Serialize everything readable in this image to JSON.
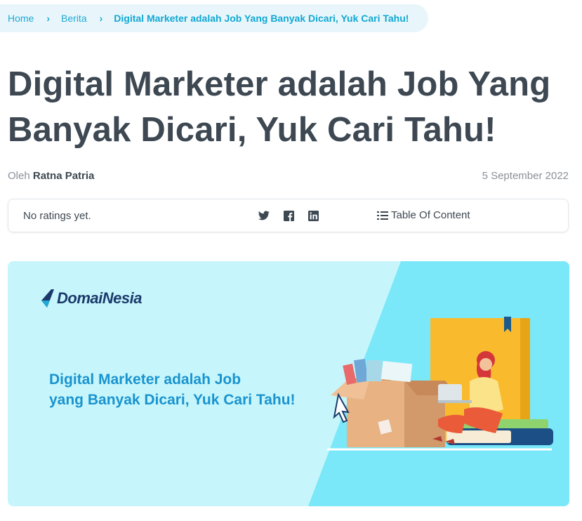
{
  "breadcrumb": {
    "items": [
      "Home",
      "Berita"
    ],
    "current": "Digital Marketer adalah Job Yang Banyak Dicari, Yuk Cari Tahu!"
  },
  "article": {
    "title": "Digital Marketer adalah Job Yang Banyak Dicari, Yuk Cari Tahu!",
    "author_prefix": "Oleh",
    "author_name": "Ratna Patria",
    "date": "5 September 2022"
  },
  "toolbar": {
    "rating_text": "No ratings yet.",
    "share_icons": [
      "twitter-icon",
      "facebook-icon",
      "linkedin-icon"
    ],
    "toc_label": "Table Of Content"
  },
  "banner": {
    "logo_text": "DomaiNesia",
    "headline_line1": "Digital Marketer adalah Job",
    "headline_line2": "yang Banyak Dicari, Yuk Cari Tahu!"
  },
  "colors": {
    "accent": "#1fa9d6",
    "title": "#3d4852",
    "banner_bg_light": "#c6f6fb",
    "banner_bg_dark": "#7ae8f8"
  }
}
